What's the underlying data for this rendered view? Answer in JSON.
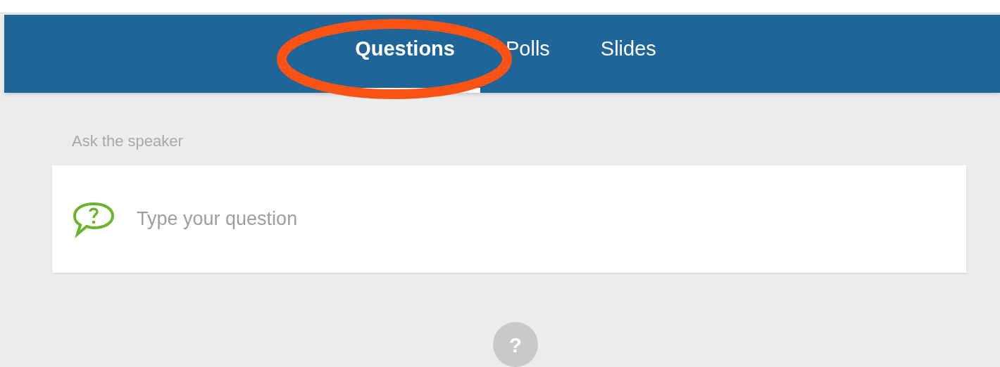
{
  "tabs": [
    {
      "label": "Questions",
      "selected": true
    },
    {
      "label": "Polls",
      "selected": false
    },
    {
      "label": "Slides",
      "selected": false
    }
  ],
  "section_label": "Ask the speaker",
  "question_field": {
    "placeholder": "Type your question"
  },
  "help_symbol": "?"
}
